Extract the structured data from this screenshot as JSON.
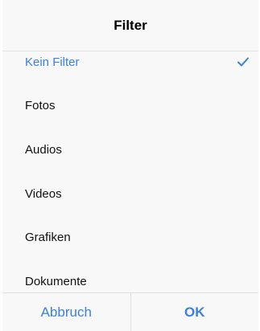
{
  "dialog": {
    "title": "Filter",
    "items": [
      {
        "label": "Kein Filter",
        "selected": true
      },
      {
        "label": "Fotos",
        "selected": false
      },
      {
        "label": "Audios",
        "selected": false
      },
      {
        "label": "Videos",
        "selected": false
      },
      {
        "label": "Grafiken",
        "selected": false
      },
      {
        "label": "Dokumente",
        "selected": false
      }
    ],
    "cancel_label": "Abbruch",
    "ok_label": "OK"
  },
  "colors": {
    "accent": "#3a7ee6",
    "background": "#f8f8f8",
    "divider": "#dedede"
  },
  "icons": {
    "selected": "checkmark-icon"
  }
}
